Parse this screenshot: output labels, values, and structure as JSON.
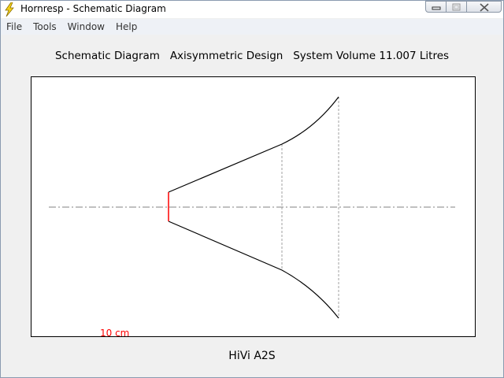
{
  "window": {
    "title": "Hornresp - Schematic Diagram"
  },
  "menu": {
    "items": [
      {
        "label": "File"
      },
      {
        "label": "Tools"
      },
      {
        "label": "Window"
      },
      {
        "label": "Help"
      }
    ]
  },
  "diagram": {
    "heading": "Schematic Diagram   Axisymmetric Design   System Volume 11.007 Litres",
    "scale_label": "10 cm",
    "driver_name": "HiVi A2S",
    "colors": {
      "throat": "#ff0000",
      "outline": "#000000",
      "axis": "#808080"
    }
  }
}
